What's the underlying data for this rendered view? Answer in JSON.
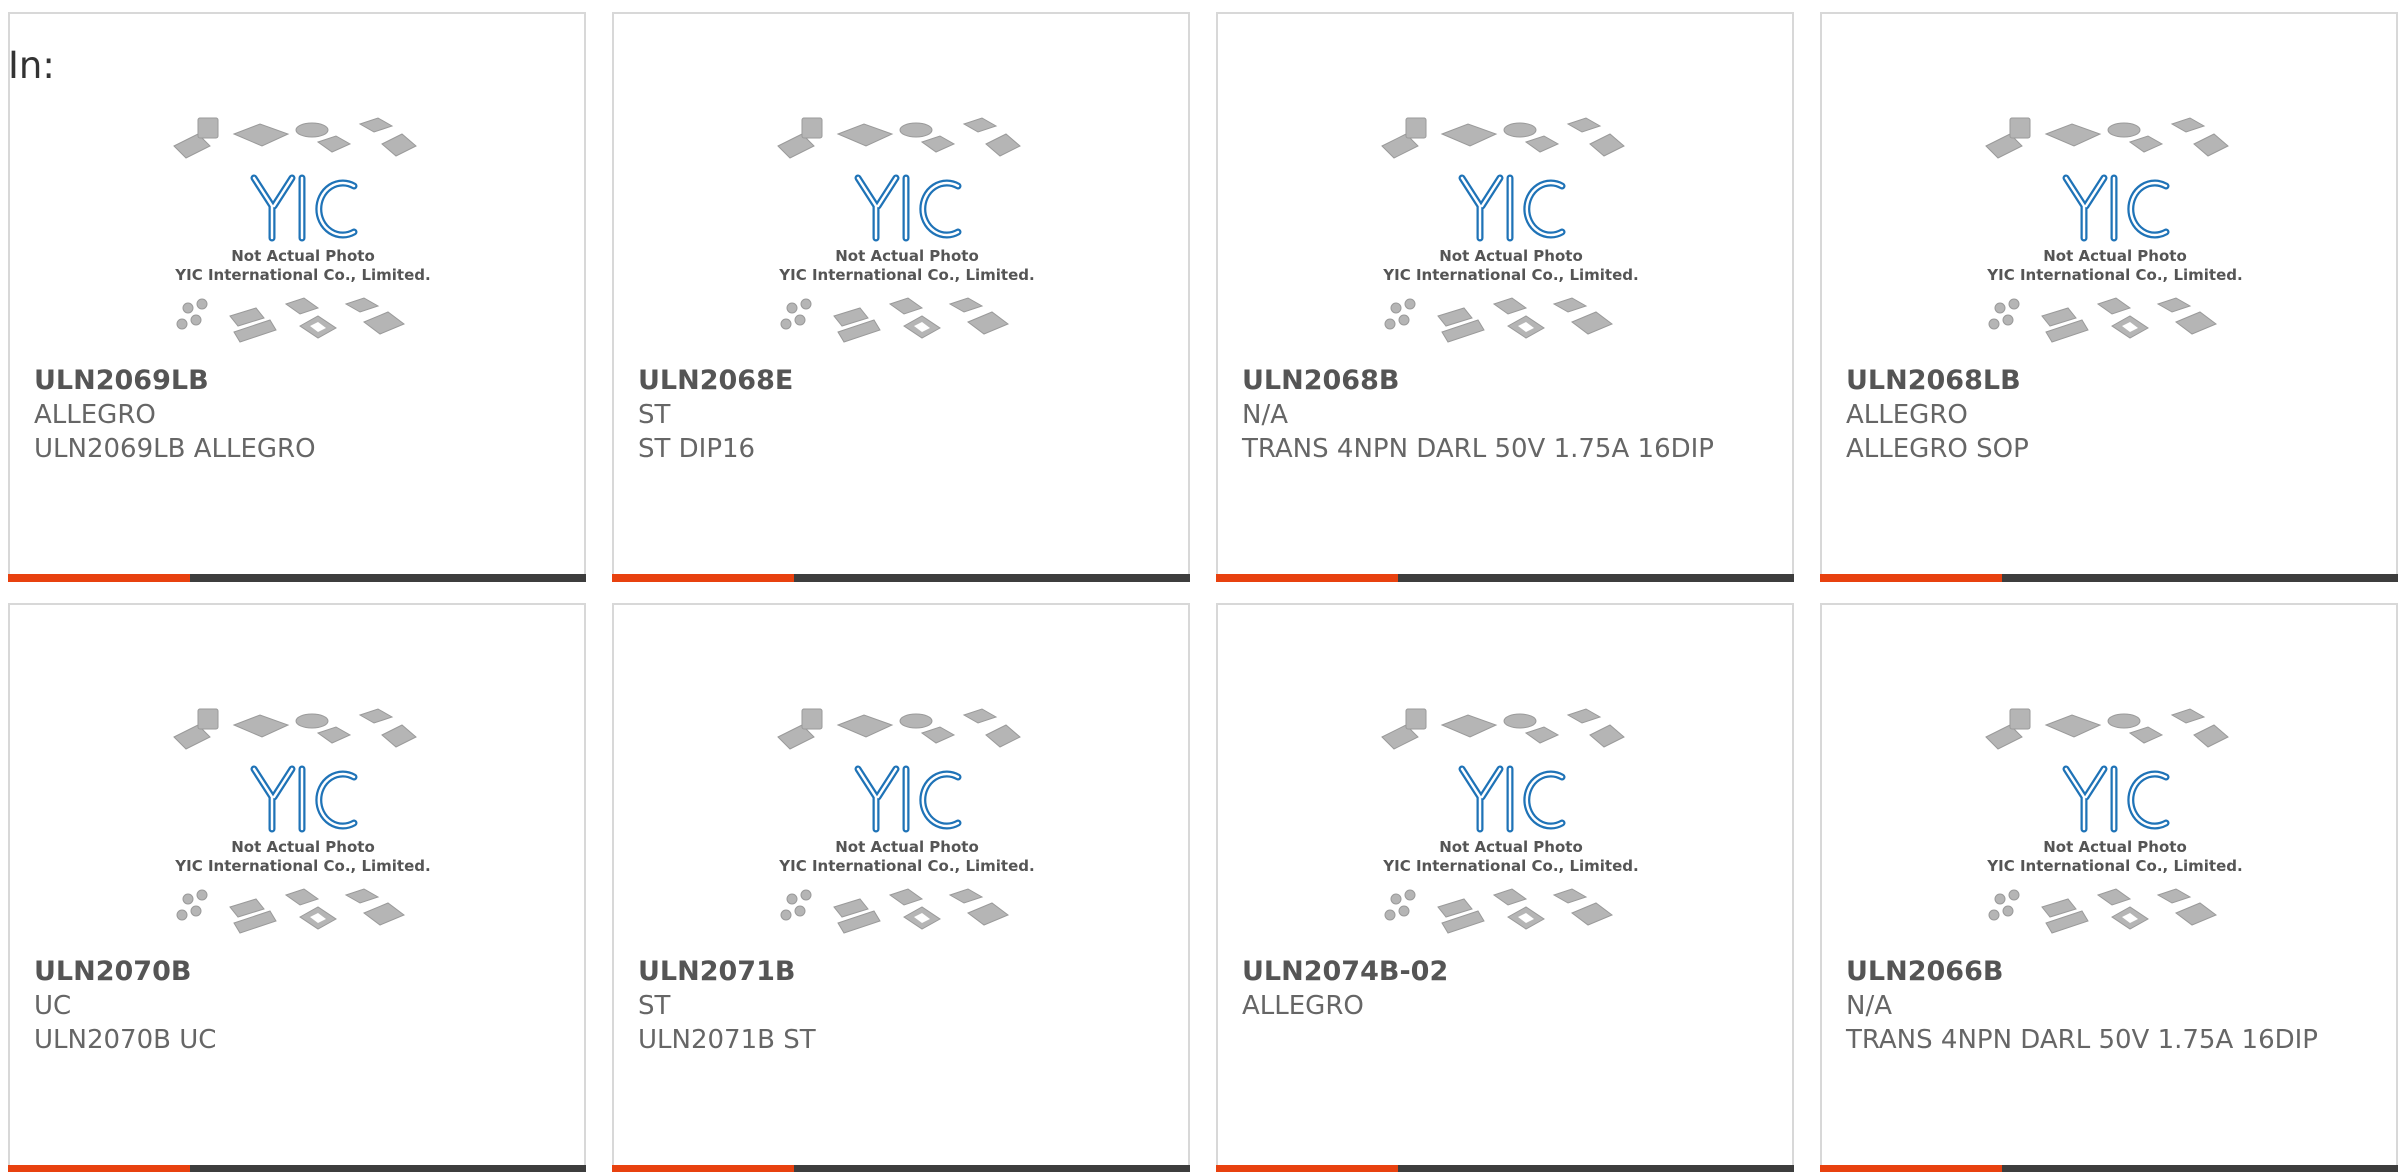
{
  "header": {
    "label": "In:"
  },
  "image": {
    "logo_text": "YIC",
    "caption_line1": "Not Actual Photo",
    "caption_line2": "YIC International Co., Limited."
  },
  "colors": {
    "accent": "#e8410f",
    "bar": "#3d3d3d",
    "logo_blue": "#1f73b7",
    "text": "#666666"
  },
  "products": [
    {
      "part_number": "ULN2069LB",
      "manufacturer": "ALLEGRO",
      "description": "ULN2069LB ALLEGRO"
    },
    {
      "part_number": "ULN2068E",
      "manufacturer": "ST",
      "description": "ST DIP16"
    },
    {
      "part_number": "ULN2068B",
      "manufacturer": "N/A",
      "description": "TRANS 4NPN DARL 50V 1.75A 16DIP"
    },
    {
      "part_number": "ULN2068LB",
      "manufacturer": "ALLEGRO",
      "description": "ALLEGRO SOP"
    },
    {
      "part_number": "ULN2070B",
      "manufacturer": "UC",
      "description": "ULN2070B UC"
    },
    {
      "part_number": "ULN2071B",
      "manufacturer": "ST",
      "description": "ULN2071B ST"
    },
    {
      "part_number": "ULN2074B-02",
      "manufacturer": "ALLEGRO",
      "description": ""
    },
    {
      "part_number": "ULN2066B",
      "manufacturer": "N/A",
      "description": "TRANS 4NPN DARL 50V 1.75A 16DIP"
    }
  ]
}
